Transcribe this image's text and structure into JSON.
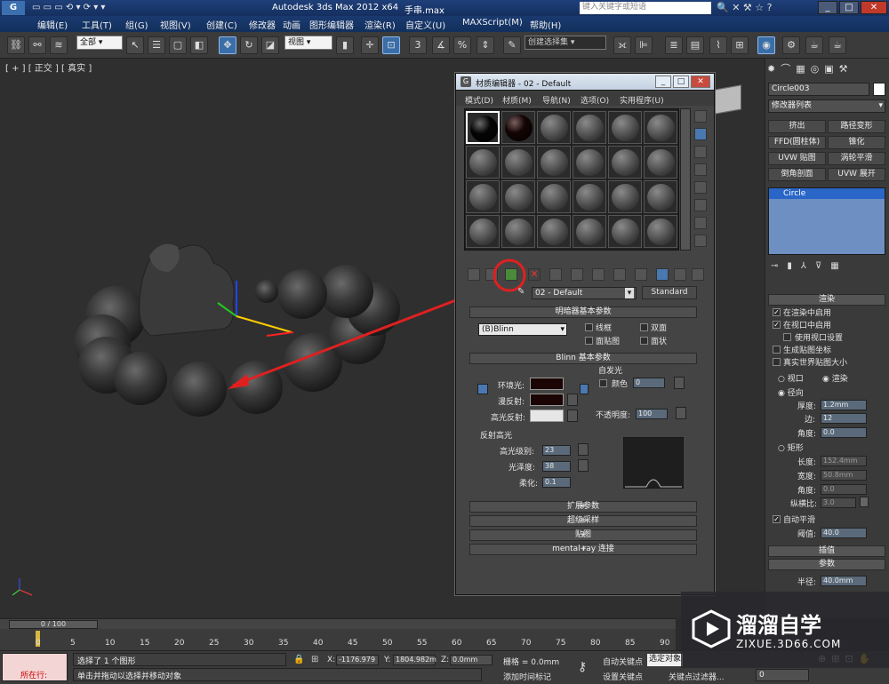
{
  "title_bar": {
    "app_title": "Autodesk 3ds Max  2012 x64",
    "file_name": "手串.max",
    "search_placeholder": "键入关键字或短语"
  },
  "menu": [
    "编辑(E)",
    "工具(T)",
    "组(G)",
    "视图(V)",
    "创建(C)",
    "修改器",
    "动画",
    "图形编辑器",
    "渲染(R)",
    "自定义(U)",
    "MAXScript(M)",
    "帮助(H)"
  ],
  "toolbar": {
    "selection_filter": "全部",
    "ref_coord": "视图",
    "named_selection": "创建选择集"
  },
  "viewport": {
    "label": "[ + ] [ 正交 ] [ 真实 ]"
  },
  "command_panel": {
    "object_name": "Circle003",
    "modifier_list": "修改器列表",
    "modifier_buttons": [
      "挤出",
      "路径变形",
      "FFD(圆柱体)",
      "锥化",
      "UVW 贴图",
      "涡轮平滑",
      "倒角剖面",
      "UVW 展开"
    ],
    "stack_item": "Circle",
    "render_rollout": {
      "title": "渲染",
      "enable_in_renderer": "在渲染中启用",
      "enable_in_viewport": "在视口中启用",
      "use_viewport_settings": "使用视口设置",
      "generate_mapping": "生成贴图坐标",
      "real_world_mapping": "真实世界贴图大小",
      "viewport_radio": "视口",
      "render_radio": "渲染",
      "radial": "径向",
      "thickness_label": "厚度:",
      "thickness": "1.2mm",
      "sides_label": "边:",
      "sides": "12",
      "angle_label": "角度:",
      "angle": "0.0",
      "rectangular": "矩形",
      "length_label": "长度:",
      "length": "152.4mm",
      "width_label": "宽度:",
      "width": "50.8mm",
      "angle2_label": "角度:",
      "angle2": "0.0",
      "aspect_label": "纵横比:",
      "aspect": "3.0",
      "auto_smooth": "自动平滑",
      "threshold_label": "阈值:",
      "threshold": "40.0"
    },
    "interpolation": "插值",
    "parameters": "参数",
    "radius_label": "半径:",
    "radius": "40.0mm"
  },
  "material_editor": {
    "title": "材质编辑器 - 02 - Default",
    "menu": [
      "模式(D)",
      "材质(M)",
      "导航(N)",
      "选项(O)",
      "实用程序(U)"
    ],
    "material_name": "02 - Default",
    "material_type": "Standard",
    "shader_rollout": "明暗器基本参数",
    "shader": "(B)Blinn",
    "wire": "线框",
    "two_sided": "双面",
    "face_map": "面贴图",
    "faceted": "面状",
    "blinn_rollout": "Blinn 基本参数",
    "self_illum": "自发光",
    "color_label": "颜色",
    "color_value": "0",
    "ambient": "环境光:",
    "diffuse": "漫反射:",
    "specular": "高光反射:",
    "opacity_label": "不透明度:",
    "opacity": "100",
    "spec_highlights": "反射高光",
    "spec_level_label": "高光级别:",
    "spec_level": "23",
    "gloss_label": "光泽度:",
    "gloss": "38",
    "soften_label": "柔化:",
    "soften": "0.1",
    "collapsed": [
      "扩展参数",
      "超级采样",
      "贴图",
      "mental ray 连接"
    ],
    "colors": {
      "ambient": "#1a0504",
      "diffuse": "#1a0504",
      "specular": "#e6e6e6"
    }
  },
  "timeline": {
    "frame": "0 / 100",
    "ticks": [
      "0",
      "5",
      "10",
      "15",
      "20",
      "25",
      "30",
      "35",
      "40",
      "45",
      "50",
      "55",
      "60",
      "65",
      "70",
      "75",
      "80",
      "85",
      "90"
    ]
  },
  "status": {
    "selection": "选择了 1 个图形",
    "prompt": "单击并拖动以选择并移动对象",
    "in_progress": "所在行:",
    "x_label": "X:",
    "x": "-1176.979",
    "y_label": "Y:",
    "y": "1804.982m",
    "z_label": "Z:",
    "z": "0.0mm",
    "grid": "栅格 = 0.0mm",
    "auto_key": "自动关键点",
    "set_key": "设置关键点",
    "key_mode": "选定对象",
    "key_filters": "关键点过滤器...",
    "add_time_tag": "添加时间标记",
    "frame_field": "0"
  },
  "watermark": {
    "brand": "溜溜自学",
    "url": "ZIXUE.3D66.COM"
  }
}
